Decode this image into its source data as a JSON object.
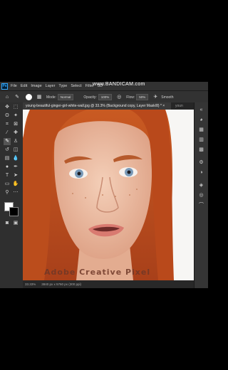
{
  "recorder_watermark": "www.BANDICAM.com",
  "menu": {
    "app_icon": "Ps",
    "items": [
      "File",
      "Edit",
      "Image",
      "Layer",
      "Type",
      "Select",
      "Filter",
      "3D"
    ]
  },
  "options_bar": {
    "mode_label": "Mode:",
    "mode_value": "Normal",
    "opacity_label": "Opacity:",
    "opacity_value": "100%",
    "flow_label": "Flow:",
    "flow_value": "50%",
    "smoothing_label": "Smooth"
  },
  "tabs": {
    "active": "young-beautiful-ginger-girl-white-wall.jpg @ 33.3% (Background copy, Layer Mask/8) * ×",
    "next": "youn"
  },
  "status_bar": {
    "zoom": "33.33%",
    "doc_info": "3840 px x 5760 px (300 ppi)"
  },
  "canvas_watermark": "Adobe Creative Pixel",
  "colors": {
    "hair": "#c4541f",
    "skin": "#eec0a6",
    "eyes": "#7a9ab8",
    "lips": "#d97a70"
  }
}
